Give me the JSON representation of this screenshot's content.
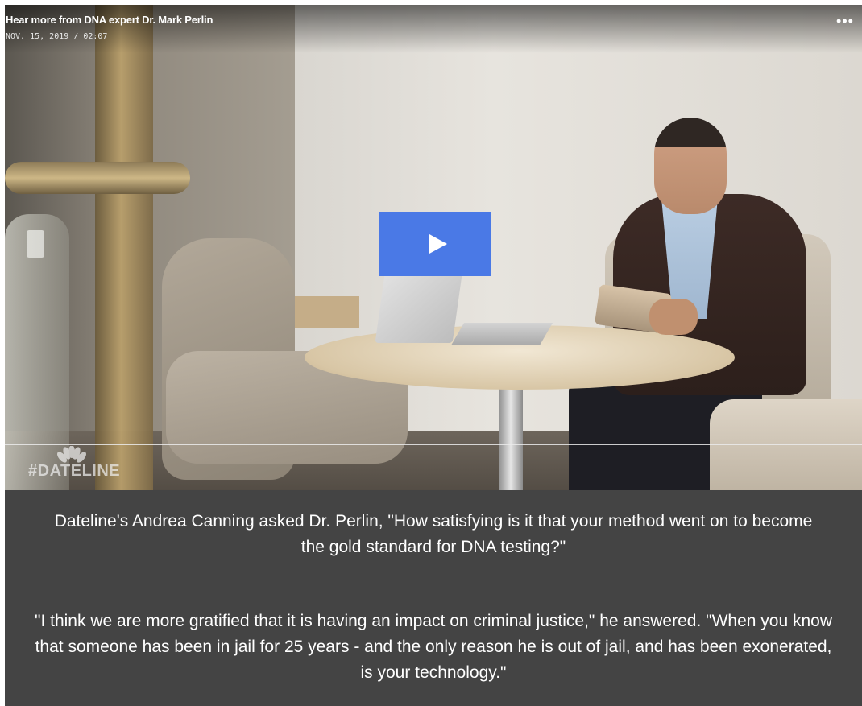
{
  "video": {
    "title": "Hear more from DNA expert Dr. Mark Perlin",
    "meta": "NOV. 15, 2019 / 02:07",
    "more_label": "•••",
    "watermark": "#DATELINE",
    "play_icon": "play-icon",
    "accent_color": "#4a79e6"
  },
  "caption": {
    "paragraph_1": "Dateline's Andrea Canning asked Dr. Perlin, \"How satisfying is it that your method went on to become the gold standard for DNA testing?\"",
    "paragraph_2": "\"I think we are more gratified that it is having an impact on criminal justice,\" he answered. \"When you know that someone has been in jail for 25 years - and the only reason he is out of jail, and has been exonerated, is your technology.\""
  }
}
